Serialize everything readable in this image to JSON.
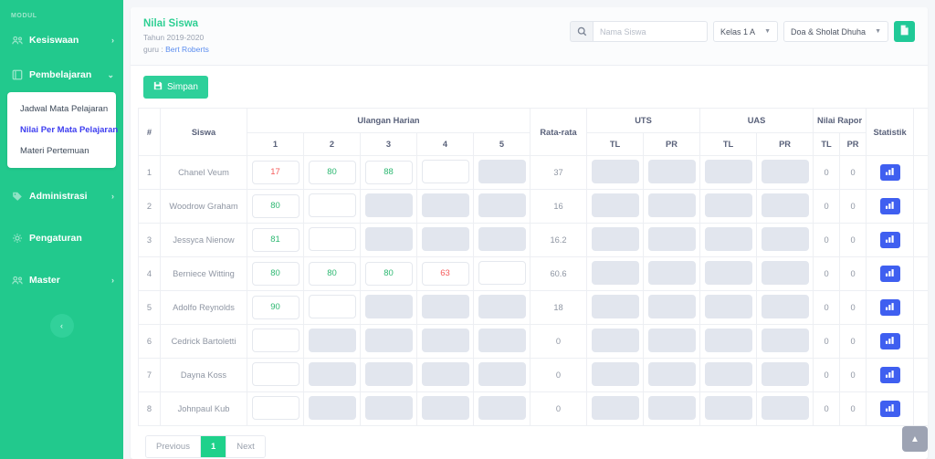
{
  "sidebar": {
    "section_label": "MODUL",
    "items": [
      {
        "label": "Kesiswaan",
        "icon": "users-icon",
        "arrow": "›",
        "expanded": false
      },
      {
        "label": "Pembelajaran",
        "icon": "book-icon",
        "arrow": "⌄",
        "expanded": true
      },
      {
        "label": "Administrasi",
        "icon": "tag-icon",
        "arrow": "›",
        "expanded": false
      },
      {
        "label": "Pengaturan",
        "icon": "gear-icon",
        "arrow": "",
        "expanded": false
      },
      {
        "label": "Master",
        "icon": "users-icon",
        "arrow": "›",
        "expanded": false
      }
    ],
    "submenu": [
      {
        "label": "Jadwal Mata Pelajaran",
        "selected": false
      },
      {
        "label": "Nilai Per Mata Pelajaran",
        "selected": true
      },
      {
        "label": "Materi Pertemuan",
        "selected": false
      }
    ],
    "collapse_icon": "chevron-left-icon",
    "bg_color": "#22c98d"
  },
  "header": {
    "title": "Nilai Siswa",
    "year_line": "Tahun 2019-2020",
    "teacher_prefix": "guru : ",
    "teacher_name": "Bert Roberts",
    "accent_color": "#2ecf93"
  },
  "filters": {
    "search_icon": "search-icon",
    "search_placeholder": "Nama Siswa",
    "search_value": "",
    "kelas_value": "Kelas 1 A",
    "mapel_value": "Doa & Sholat Dhuha",
    "caret": "▼",
    "export_icon": "excel-file-icon"
  },
  "toolbar": {
    "save_label": "Simpan",
    "save_icon": "floppy-disk-icon"
  },
  "table": {
    "group_headers": {
      "hash": "#",
      "siswa": "Siswa",
      "ulangan_harian": "Ulangan Harian",
      "rata_rata": "Rata-rata",
      "uts": "UTS",
      "uas": "UAS",
      "nilai_rapor": "Nilai Rapor",
      "statistik": "Statistik"
    },
    "uh_columns": [
      "1",
      "2",
      "3",
      "4",
      "5"
    ],
    "sub_tl": "TL",
    "sub_pr": "PR",
    "stat_icon": "bar-chart-icon",
    "rows": [
      {
        "no": "1",
        "name": "Chanel Veum",
        "uh": [
          {
            "value": "17",
            "state": "bad"
          },
          {
            "value": "80",
            "state": "good"
          },
          {
            "value": "88",
            "state": "good"
          },
          {
            "value": "",
            "state": "empty"
          },
          {
            "value": "",
            "state": "disabled"
          }
        ],
        "rata": "37",
        "uts": [
          {
            "value": "",
            "state": "disabled"
          },
          {
            "value": "",
            "state": "disabled"
          }
        ],
        "uas": [
          {
            "value": "",
            "state": "disabled"
          },
          {
            "value": "",
            "state": "disabled"
          }
        ],
        "rapor_tl": "0",
        "rapor_pr": "0"
      },
      {
        "no": "2",
        "name": "Woodrow Graham",
        "uh": [
          {
            "value": "80",
            "state": "good"
          },
          {
            "value": "",
            "state": "empty"
          },
          {
            "value": "",
            "state": "disabled"
          },
          {
            "value": "",
            "state": "disabled"
          },
          {
            "value": "",
            "state": "disabled"
          }
        ],
        "rata": "16",
        "uts": [
          {
            "value": "",
            "state": "disabled"
          },
          {
            "value": "",
            "state": "disabled"
          }
        ],
        "uas": [
          {
            "value": "",
            "state": "disabled"
          },
          {
            "value": "",
            "state": "disabled"
          }
        ],
        "rapor_tl": "0",
        "rapor_pr": "0"
      },
      {
        "no": "3",
        "name": "Jessyca Nienow",
        "uh": [
          {
            "value": "81",
            "state": "good"
          },
          {
            "value": "",
            "state": "empty"
          },
          {
            "value": "",
            "state": "disabled"
          },
          {
            "value": "",
            "state": "disabled"
          },
          {
            "value": "",
            "state": "disabled"
          }
        ],
        "rata": "16.2",
        "uts": [
          {
            "value": "",
            "state": "disabled"
          },
          {
            "value": "",
            "state": "disabled"
          }
        ],
        "uas": [
          {
            "value": "",
            "state": "disabled"
          },
          {
            "value": "",
            "state": "disabled"
          }
        ],
        "rapor_tl": "0",
        "rapor_pr": "0"
      },
      {
        "no": "4",
        "name": "Berniece Witting",
        "uh": [
          {
            "value": "80",
            "state": "good"
          },
          {
            "value": "80",
            "state": "good"
          },
          {
            "value": "80",
            "state": "good"
          },
          {
            "value": "63",
            "state": "bad"
          },
          {
            "value": "",
            "state": "empty"
          }
        ],
        "rata": "60.6",
        "uts": [
          {
            "value": "",
            "state": "disabled"
          },
          {
            "value": "",
            "state": "disabled"
          }
        ],
        "uas": [
          {
            "value": "",
            "state": "disabled"
          },
          {
            "value": "",
            "state": "disabled"
          }
        ],
        "rapor_tl": "0",
        "rapor_pr": "0"
      },
      {
        "no": "5",
        "name": "Adolfo Reynolds",
        "uh": [
          {
            "value": "90",
            "state": "good"
          },
          {
            "value": "",
            "state": "empty"
          },
          {
            "value": "",
            "state": "disabled"
          },
          {
            "value": "",
            "state": "disabled"
          },
          {
            "value": "",
            "state": "disabled"
          }
        ],
        "rata": "18",
        "uts": [
          {
            "value": "",
            "state": "disabled"
          },
          {
            "value": "",
            "state": "disabled"
          }
        ],
        "uas": [
          {
            "value": "",
            "state": "disabled"
          },
          {
            "value": "",
            "state": "disabled"
          }
        ],
        "rapor_tl": "0",
        "rapor_pr": "0"
      },
      {
        "no": "6",
        "name": "Cedrick Bartoletti",
        "uh": [
          {
            "value": "",
            "state": "empty"
          },
          {
            "value": "",
            "state": "disabled"
          },
          {
            "value": "",
            "state": "disabled"
          },
          {
            "value": "",
            "state": "disabled"
          },
          {
            "value": "",
            "state": "disabled"
          }
        ],
        "rata": "0",
        "uts": [
          {
            "value": "",
            "state": "disabled"
          },
          {
            "value": "",
            "state": "disabled"
          }
        ],
        "uas": [
          {
            "value": "",
            "state": "disabled"
          },
          {
            "value": "",
            "state": "disabled"
          }
        ],
        "rapor_tl": "0",
        "rapor_pr": "0"
      },
      {
        "no": "7",
        "name": "Dayna Koss",
        "uh": [
          {
            "value": "",
            "state": "empty"
          },
          {
            "value": "",
            "state": "disabled"
          },
          {
            "value": "",
            "state": "disabled"
          },
          {
            "value": "",
            "state": "disabled"
          },
          {
            "value": "",
            "state": "disabled"
          }
        ],
        "rata": "0",
        "uts": [
          {
            "value": "",
            "state": "disabled"
          },
          {
            "value": "",
            "state": "disabled"
          }
        ],
        "uas": [
          {
            "value": "",
            "state": "disabled"
          },
          {
            "value": "",
            "state": "disabled"
          }
        ],
        "rapor_tl": "0",
        "rapor_pr": "0"
      },
      {
        "no": "8",
        "name": "Johnpaul Kub",
        "uh": [
          {
            "value": "",
            "state": "empty"
          },
          {
            "value": "",
            "state": "disabled"
          },
          {
            "value": "",
            "state": "disabled"
          },
          {
            "value": "",
            "state": "disabled"
          },
          {
            "value": "",
            "state": "disabled"
          }
        ],
        "rata": "0",
        "uts": [
          {
            "value": "",
            "state": "disabled"
          },
          {
            "value": "",
            "state": "disabled"
          }
        ],
        "uas": [
          {
            "value": "",
            "state": "disabled"
          },
          {
            "value": "",
            "state": "disabled"
          }
        ],
        "rapor_tl": "0",
        "rapor_pr": "0"
      }
    ]
  },
  "pagination": {
    "previous": "Previous",
    "pages": [
      "1"
    ],
    "current": "1",
    "next": "Next"
  },
  "scroll_top": {
    "icon": "chevron-up-icon"
  }
}
